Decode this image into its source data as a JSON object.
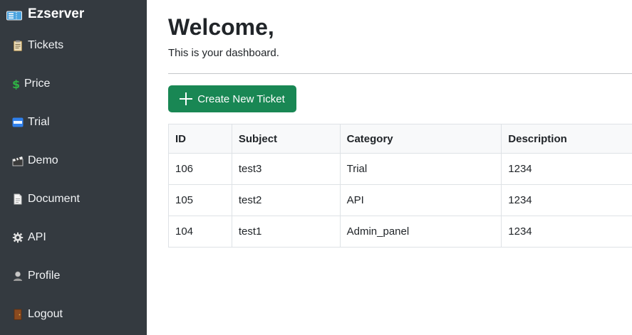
{
  "sidebar": {
    "brand": "Ezserver",
    "items": [
      {
        "label": "Tickets",
        "icon": "clipboard-icon"
      },
      {
        "label": "Price",
        "icon": "dollar-icon"
      },
      {
        "label": "Trial",
        "icon": "free-icon"
      },
      {
        "label": "Demo",
        "icon": "clapper-icon"
      },
      {
        "label": "Document",
        "icon": "document-icon"
      },
      {
        "label": "API",
        "icon": "gear-icon"
      },
      {
        "label": "Profile",
        "icon": "user-icon"
      },
      {
        "label": "Logout",
        "icon": "door-icon"
      }
    ]
  },
  "main": {
    "title": "Welcome,",
    "subtitle": "This is your dashboard.",
    "create_button": "Create New Ticket"
  },
  "table": {
    "headers": [
      "ID",
      "Subject",
      "Category",
      "Description"
    ],
    "rows": [
      [
        "106",
        "test3",
        "Trial",
        "1234"
      ],
      [
        "105",
        "test2",
        "API",
        "1234"
      ],
      [
        "104",
        "test1",
        "Admin_panel",
        "1234"
      ]
    ]
  },
  "colors": {
    "sidebar_bg": "#343a40",
    "primary_button": "#198754",
    "table_header_bg": "#f8f9fa"
  }
}
